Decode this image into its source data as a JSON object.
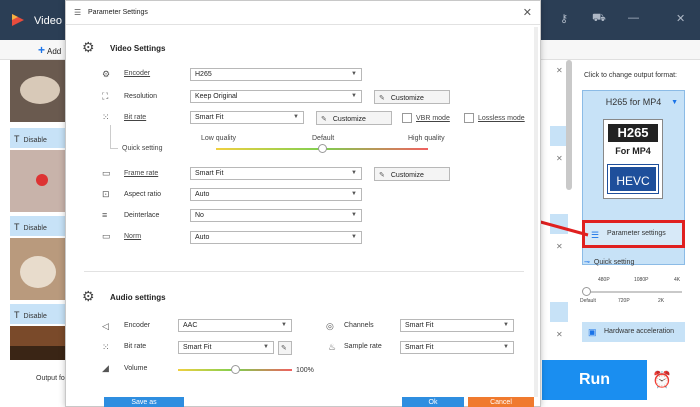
{
  "app": {
    "title": "Video C",
    "add_label": "Add",
    "disable_label": "Disable",
    "output_footer": "Output fo",
    "right_panel": {
      "click_label": "Click to change output format:",
      "format_name": "H265 for MP4",
      "format_icon": {
        "top": "H265",
        "mid": "For MP4",
        "bot": "HEVC"
      },
      "param_button": "Parameter settings",
      "quick_setting": "Quick setting",
      "qs_ticks": [
        "480P",
        "1080P",
        "4K",
        "Default",
        "720P",
        "2K"
      ],
      "hw_button": "Hardware acceleration"
    },
    "run_label": "Run",
    "accent_color": "#1a8ef0",
    "highlight_color": "#e02020"
  },
  "dialog": {
    "title": "Parameter Settings",
    "video_section": "Video Settings",
    "video": {
      "encoder": {
        "label": "Encoder",
        "value": "H265"
      },
      "resolution": {
        "label": "Resolution",
        "value": "Keep Original",
        "customize": "Customize"
      },
      "bitrate": {
        "label": "Bit rate",
        "value": "Smart Fit",
        "customize": "Customize",
        "vbr": "VBR mode",
        "lossless": "Lossless mode"
      },
      "quality": {
        "low": "Low quality",
        "default": "Default",
        "high": "High quality",
        "quick": "Quick setting",
        "level": 0.5
      },
      "framerate": {
        "label": "Frame rate",
        "value": "Smart Fit",
        "customize": "Customize"
      },
      "aspect": {
        "label": "Aspect ratio",
        "value": "Auto"
      },
      "deinterlace": {
        "label": "Deinterlace",
        "value": "No"
      },
      "norm": {
        "label": "Norm",
        "value": "Auto"
      }
    },
    "audio_section": "Audio settings",
    "audio": {
      "encoder": {
        "label": "Encoder",
        "value": "AAC"
      },
      "channels": {
        "label": "Channels",
        "value": "Smart Fit"
      },
      "bitrate": {
        "label": "Bit rate",
        "value": "Smart Fit"
      },
      "samplerate": {
        "label": "Sample rate",
        "value": "Smart Fit"
      },
      "volume": {
        "label": "Volume",
        "value": "100%",
        "level": 0.5
      }
    },
    "footer": {
      "save_as": "Save as",
      "ok": "Ok",
      "cancel": "Cancel"
    }
  }
}
